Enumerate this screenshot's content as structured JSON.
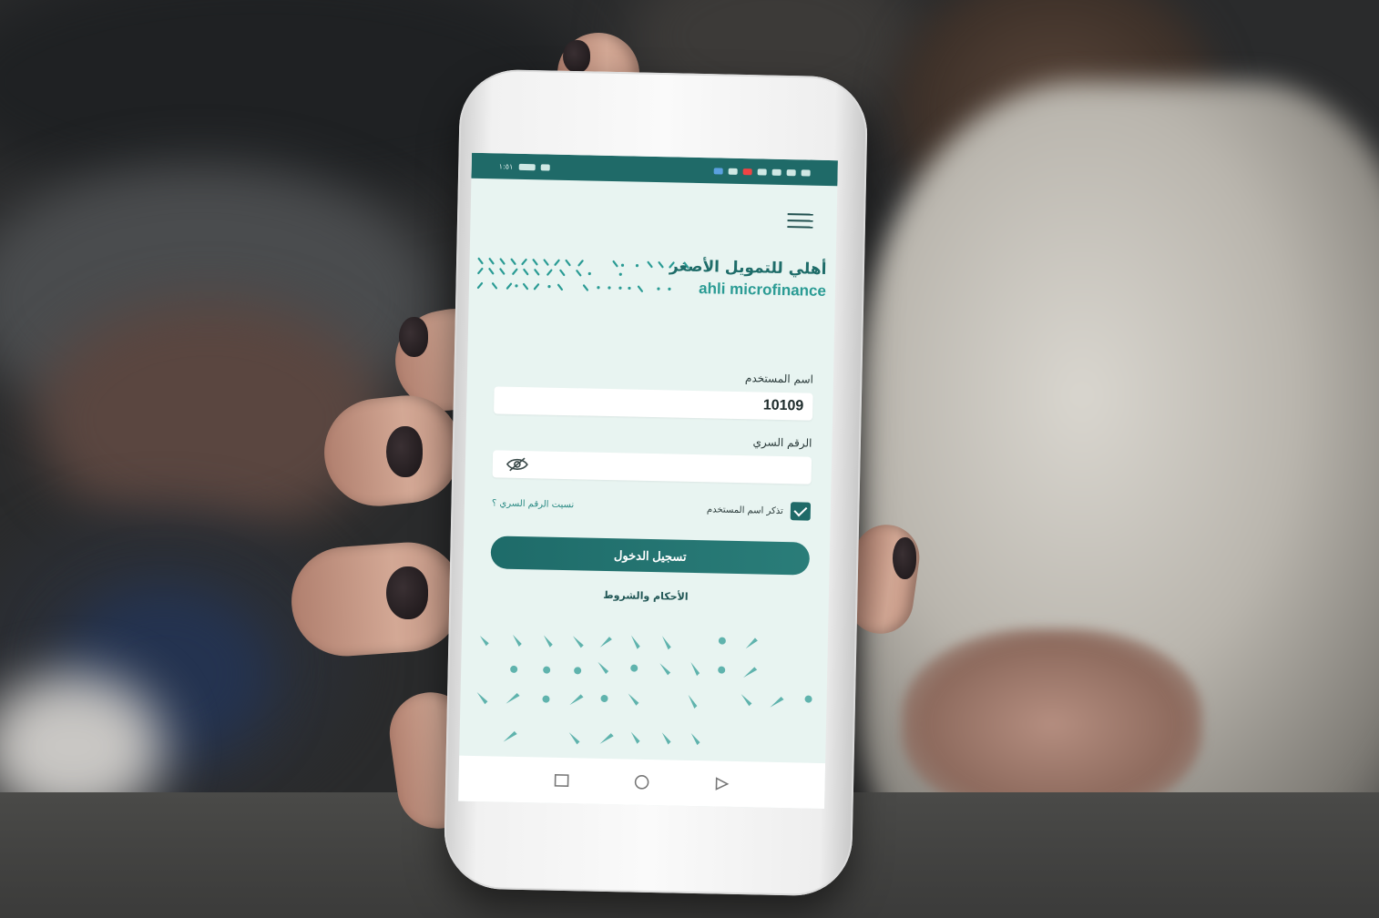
{
  "status_bar": {
    "time": "١:٥١"
  },
  "brand": {
    "name_ar": "أهلي للتمويل الأصغر",
    "name_en": "ahli microfinance"
  },
  "login_form": {
    "username_label": "اسم المستخدم",
    "username_value": "10109",
    "password_label": "الرقم السري",
    "password_value": "",
    "remember_label": "تذكر اسم المستخدم",
    "remember_checked": true,
    "forgot_link": "نسيت الرقم السري ؟",
    "login_button": "تسجيل الدخول",
    "terms_link": "الأحكام والشروط"
  },
  "icons": {
    "menu": "hamburger-menu-icon",
    "password_toggle": "eye-slash-icon",
    "checkbox": "checkmark-icon",
    "nav_recent": "square-icon",
    "nav_home": "circle-icon",
    "nav_back": "triangle-icon"
  },
  "colors": {
    "primary": "#1f6a68",
    "accent": "#2a9b94",
    "screen_bg": "#e8f4f1"
  }
}
